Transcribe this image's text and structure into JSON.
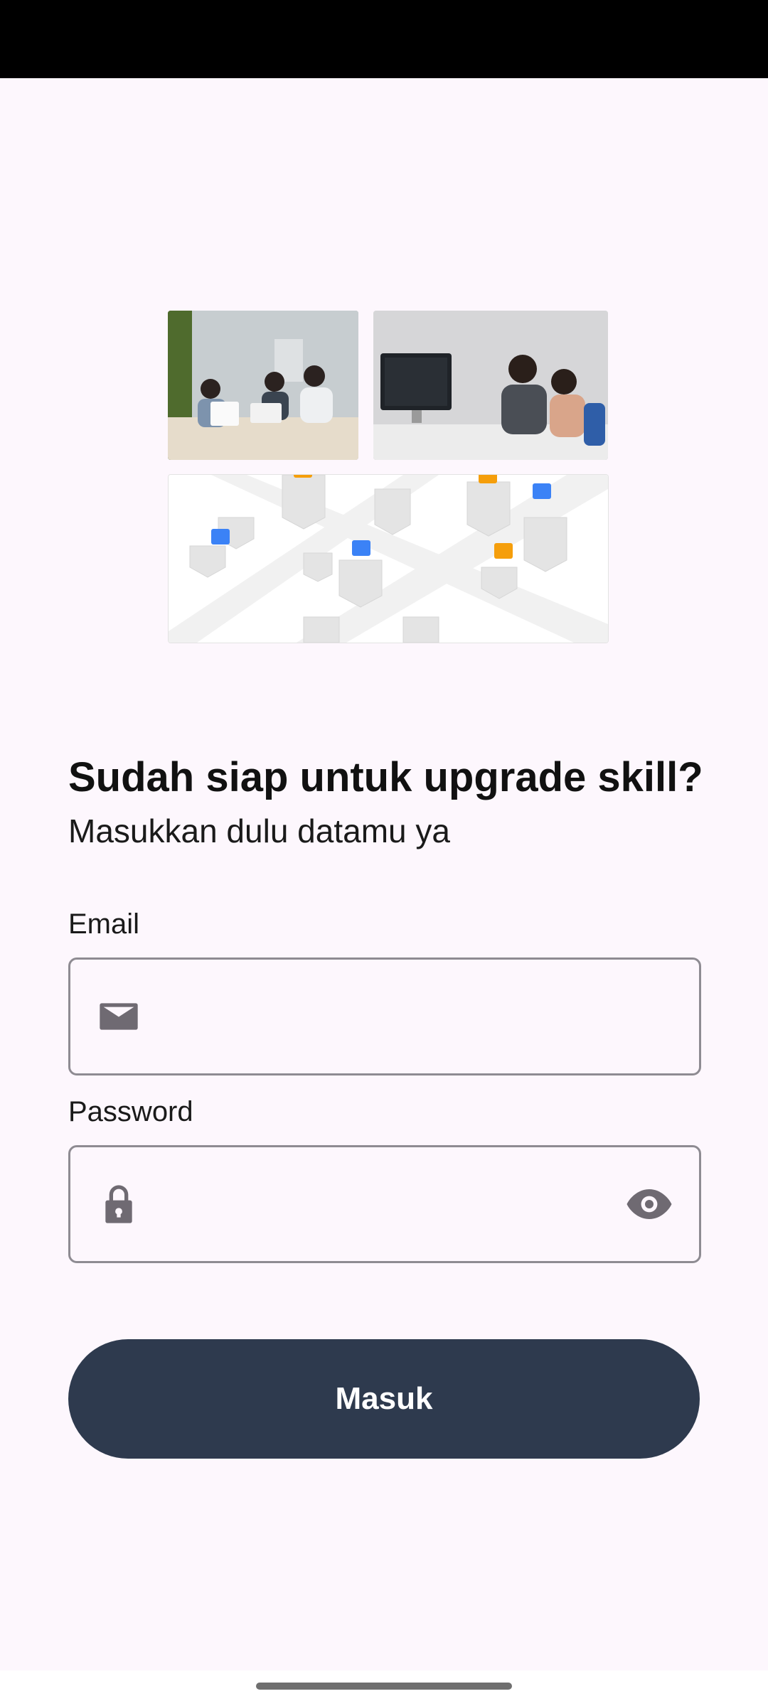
{
  "login": {
    "title": "Sudah siap untuk upgrade skill?",
    "subtitle": "Masukkan dulu datamu ya",
    "email_label": "Email",
    "email_value": "",
    "password_label": "Password",
    "password_value": "",
    "submit_label": "Masuk"
  },
  "icons": {
    "email": "mail-icon",
    "password": "lock-icon",
    "toggle_password": "eye-icon"
  },
  "colors": {
    "background": "#fdf7fd",
    "button": "#2e3a4e",
    "button_text": "#ffffff",
    "field_border": "#8e8b92",
    "icon": "#6f6a72",
    "pin_orange": "#f59e0b",
    "pin_blue": "#3b82f6"
  }
}
